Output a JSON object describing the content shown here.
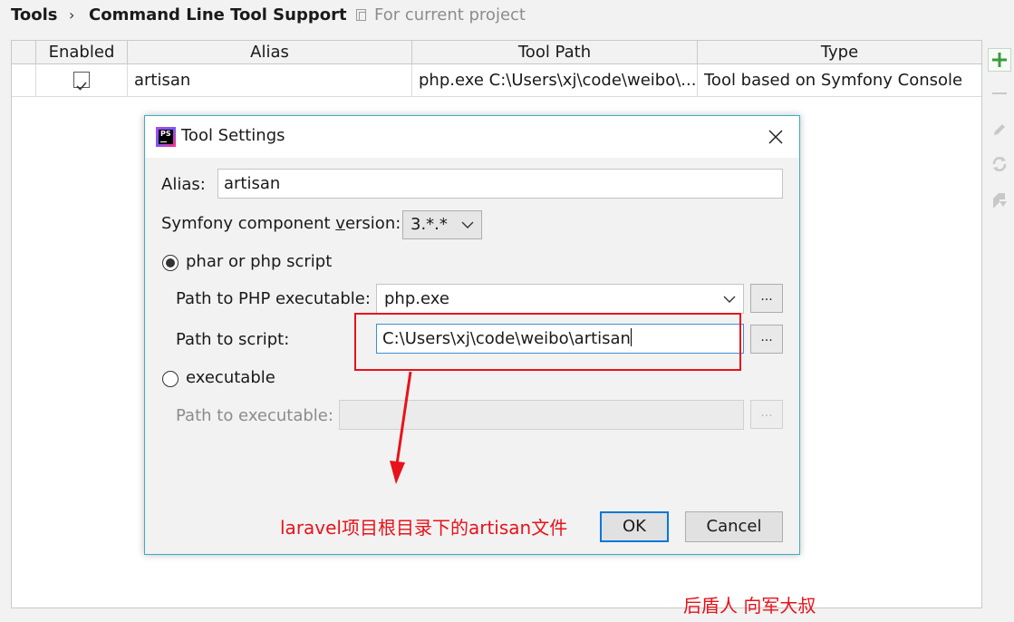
{
  "breadcrumb": {
    "root": "Tools",
    "separator": "›",
    "current": "Command Line Tool Support",
    "scope": "For current project"
  },
  "table": {
    "headers": [
      "Enabled",
      "Alias",
      "Tool Path",
      "Type"
    ],
    "rows": [
      {
        "enabled": true,
        "alias": "artisan",
        "tool_path": "php.exe C:\\Users\\xj\\code\\weibo\\...",
        "type": "Tool based on Symfony Console"
      }
    ]
  },
  "toolbar": {
    "icons": [
      "add-icon",
      "remove-icon",
      "edit-icon",
      "reload-icon",
      "export-icon"
    ],
    "add_color": "#3c9b3c"
  },
  "dialog": {
    "title": "Tool Settings",
    "alias_label": "Alias:",
    "alias_value": "artisan",
    "version_label_pre": "Symfony component ",
    "version_label_mnemonic": "v",
    "version_label_post": "ersion:",
    "version_value": "3.*.*",
    "phar_radio_label": "phar or php script",
    "phar_selected": true,
    "php_exe_label": "Path to PHP executable:",
    "php_exe_value": "php.exe",
    "script_label": "Path to script:",
    "script_value": "C:\\Users\\xj\\code\\weibo\\artisan",
    "browse_label": "...",
    "executable_radio_label": "executable",
    "executable_path_label": "Path to executable:",
    "executable_path_value": "",
    "ok_label": "OK",
    "cancel_label": "Cancel"
  },
  "annotations": {
    "note": "laravel项目根目录下的artisan文件",
    "watermark": "后盾人 向军大叔",
    "color": "#e8121a"
  }
}
